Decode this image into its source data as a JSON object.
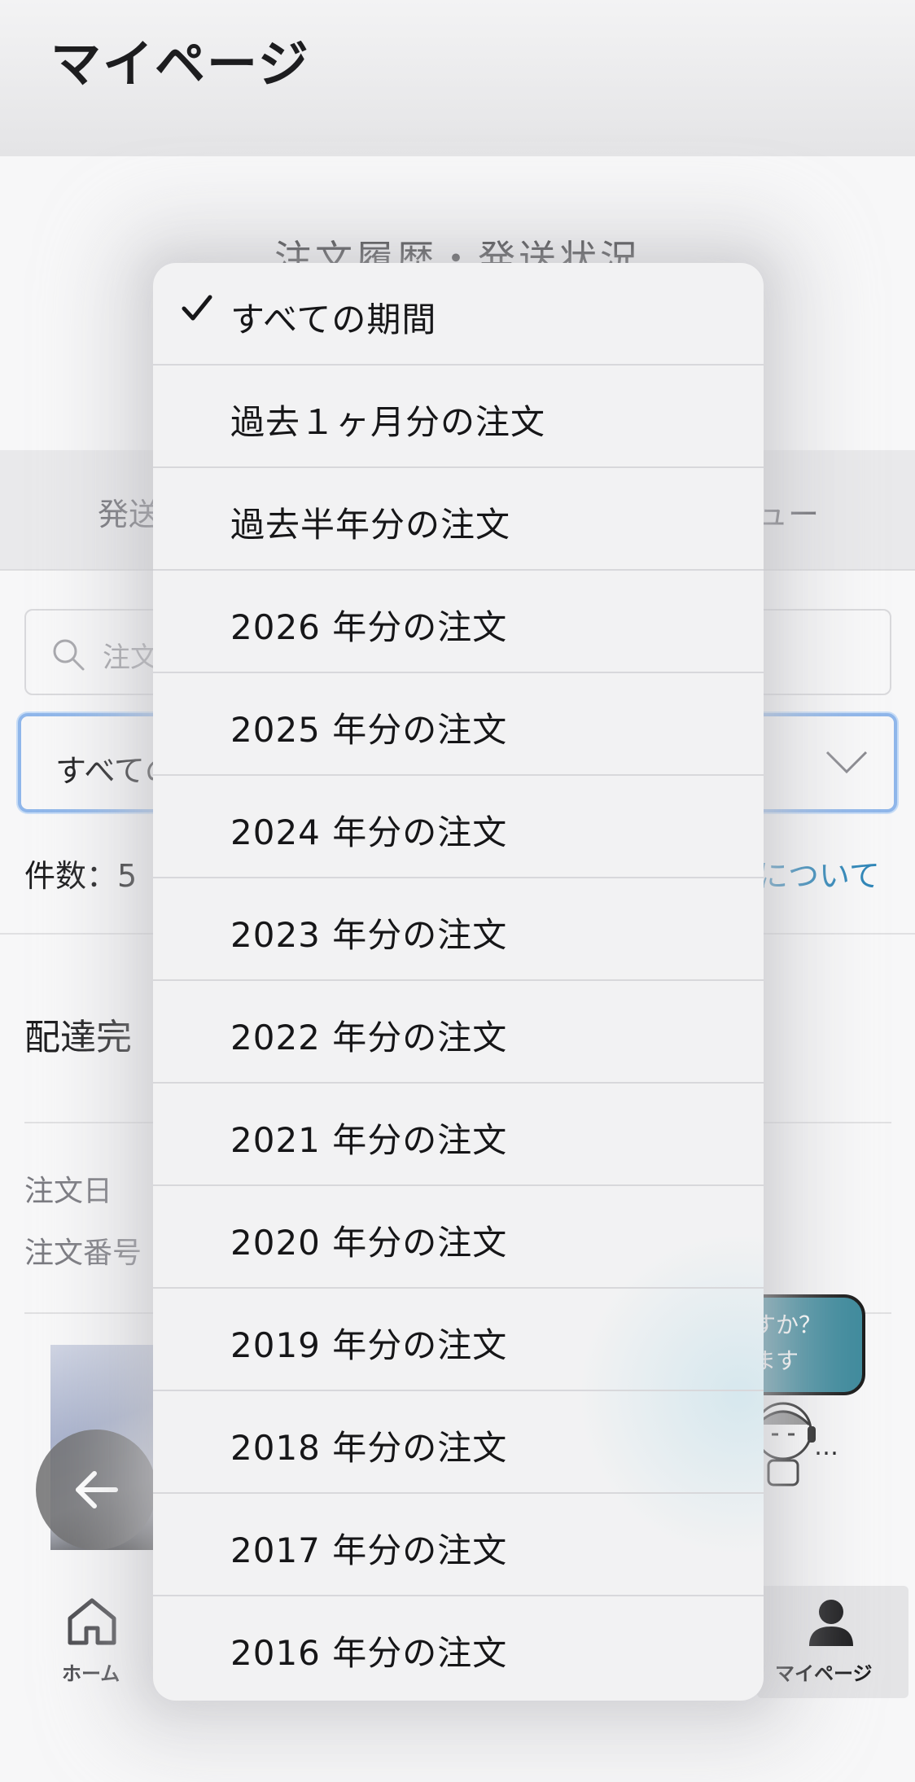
{
  "header": {
    "title": "マイページ"
  },
  "section": {
    "title": "注文履歴・発送状況"
  },
  "tabs": {
    "left_partial": "発送",
    "right_partial": "ュー"
  },
  "search": {
    "placeholder_partial": "注文"
  },
  "period_select": {
    "value_partial": "すべての"
  },
  "summary": {
    "count_partial": "件数：5",
    "link_partial": "について"
  },
  "order": {
    "status_partial": "配達完",
    "date_label": "注文日",
    "number_label_partial": "注文番号"
  },
  "help": {
    "line1_partial": "すか？",
    "line2_partial": "ます",
    "ellipsis": "…"
  },
  "bottom_nav": {
    "home_label": "ホーム",
    "mypage_label": "マイページ"
  },
  "dropdown": {
    "selected_index": 0,
    "options": [
      "すべての期間",
      "過去１ヶ月分の注文",
      "過去半年分の注文",
      "2026 年分の注文",
      "2025 年分の注文",
      "2024 年分の注文",
      "2023 年分の注文",
      "2022 年分の注文",
      "2021 年分の注文",
      "2020 年分の注文",
      "2019 年分の注文",
      "2018 年分の注文",
      "2017 年分の注文",
      "2016 年分の注文"
    ]
  },
  "colors": {
    "accent_link": "#2f86b8",
    "select_focus": "#8fb6ea",
    "help_bubble": "#3e8a9c"
  },
  "icons": {
    "search": "search-icon",
    "chevron": "chevron-down-icon",
    "back": "arrow-left-icon",
    "home": "home-icon",
    "user": "user-icon",
    "check": "checkmark-icon"
  }
}
